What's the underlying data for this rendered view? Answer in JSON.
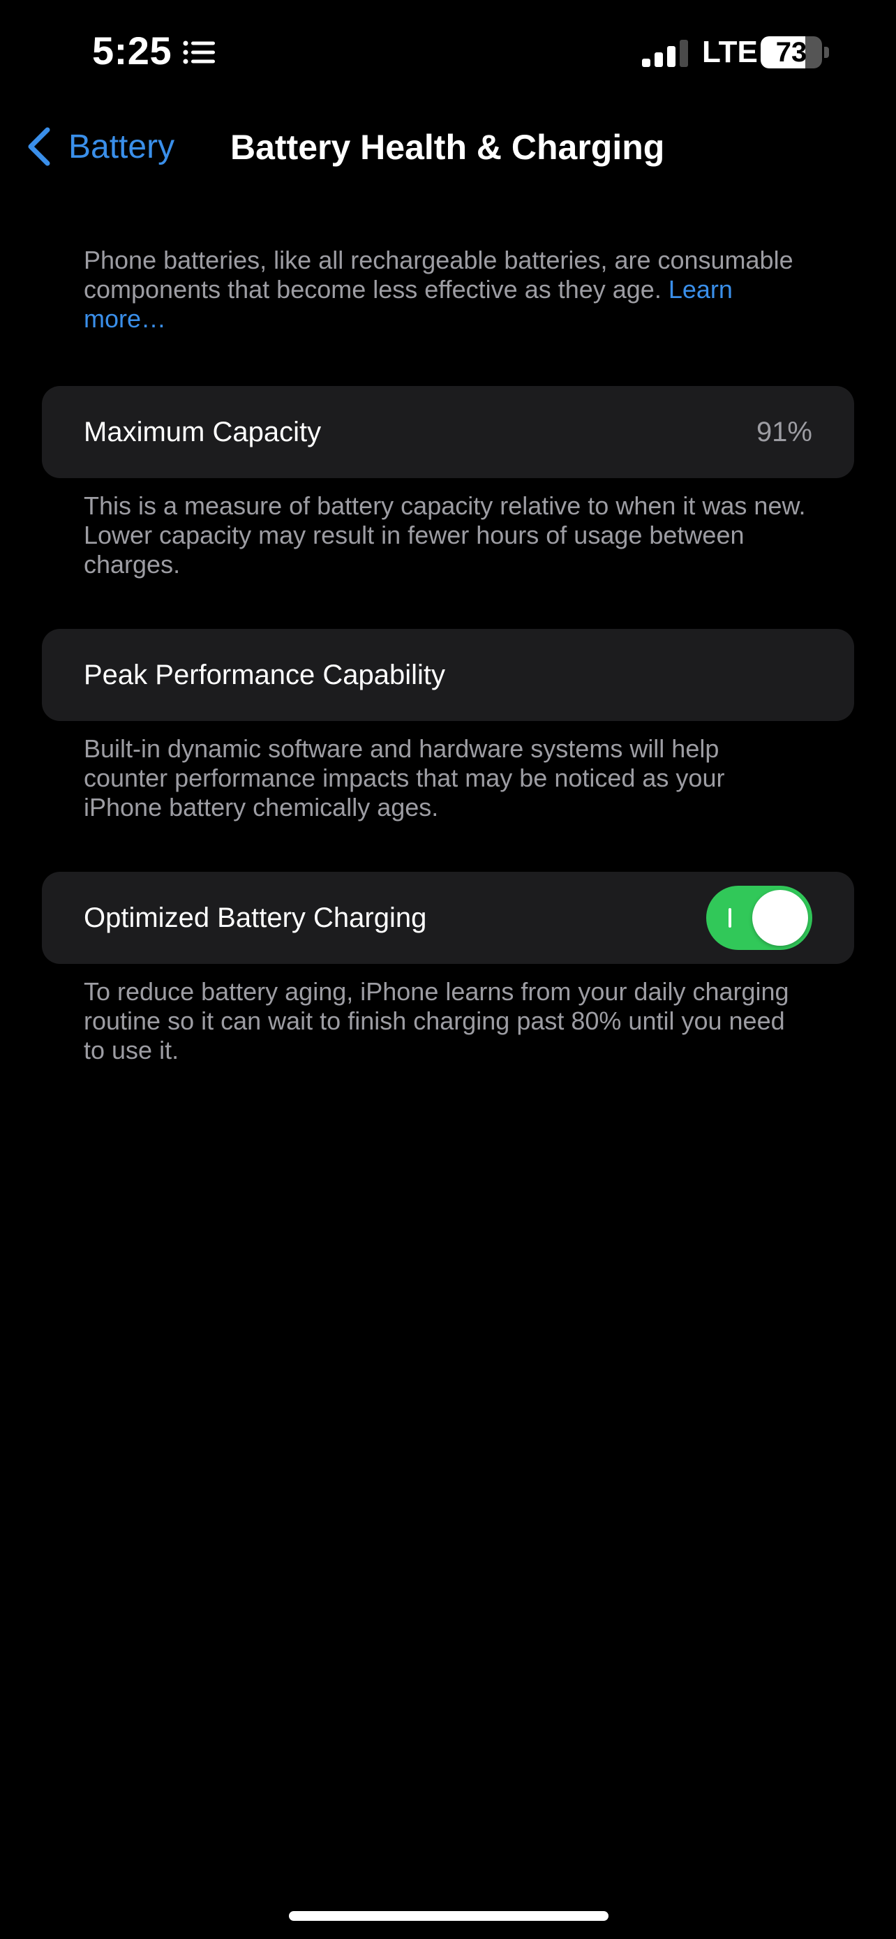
{
  "status_bar": {
    "time": "5:25",
    "network": "LTE",
    "battery_level": 73,
    "battery_text": "73",
    "signal_bars_active": 3,
    "signal_bars_total": 4
  },
  "nav": {
    "back_label": "Battery",
    "title": "Battery Health & Charging"
  },
  "intro": {
    "text": "Phone batteries, like all rechargeable batteries, are consumable components that become less effective as they age. ",
    "link": "Learn more…"
  },
  "maximum_capacity": {
    "label": "Maximum Capacity",
    "value": "91%",
    "description": "This is a measure of battery capacity relative to when it was new. Lower capacity may result in fewer hours of usage between charges."
  },
  "peak_performance": {
    "label": "Peak Performance Capability",
    "description": "Built-in dynamic software and hardware systems will help counter performance impacts that may be noticed as your iPhone battery chemically ages."
  },
  "optimized_charging": {
    "label": "Optimized Battery Charging",
    "enabled": true,
    "description": "To reduce battery aging, iPhone learns from your daily charging routine so it can wait to finish charging past 80% until you need to use it."
  },
  "colors": {
    "background": "#000000",
    "card": "#1c1c1e",
    "accent": "#3a8fea",
    "toggle_on": "#31c859",
    "secondary_text": "#9d9da3"
  },
  "icons": {
    "back": "chevron-left-icon",
    "focus": "list-icon",
    "signal": "cellular-signal-icon",
    "battery": "battery-icon"
  }
}
